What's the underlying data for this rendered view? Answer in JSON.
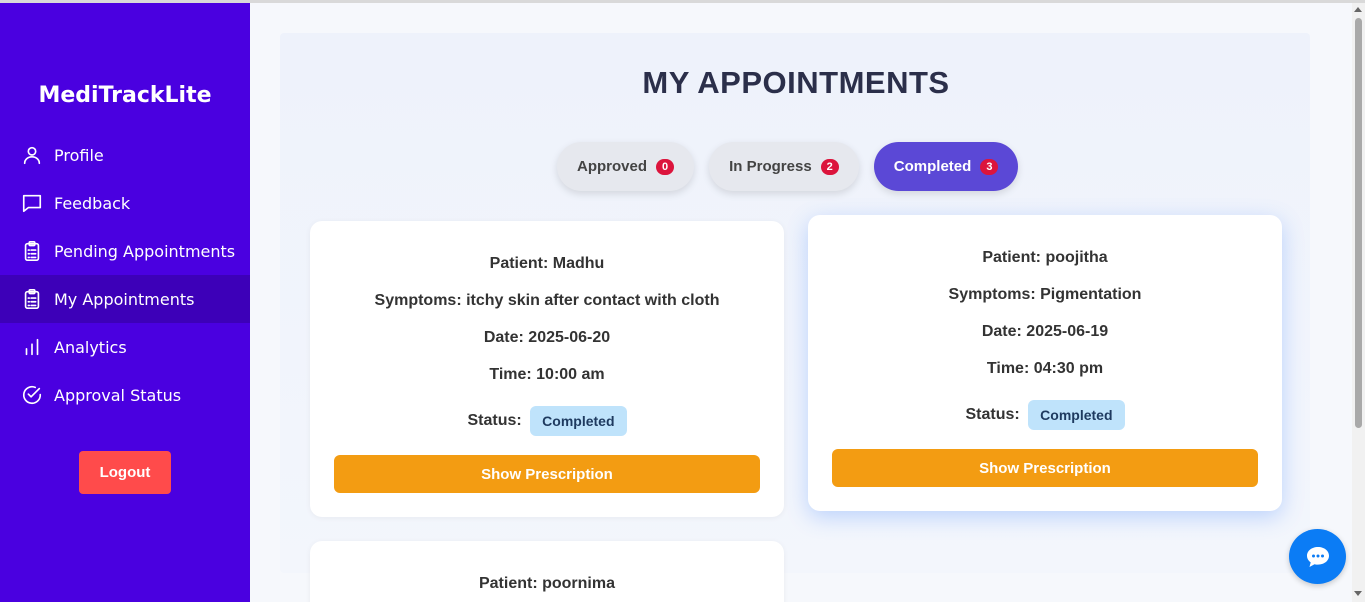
{
  "sidebar": {
    "brand": "MediTrackLite",
    "items": [
      {
        "label": "Profile",
        "icon": "user-icon"
      },
      {
        "label": "Feedback",
        "icon": "chat-bubble-icon"
      },
      {
        "label": "Pending Appointments",
        "icon": "clipboard-icon"
      },
      {
        "label": "My Appointments",
        "icon": "clipboard-icon",
        "active": true
      },
      {
        "label": "Analytics",
        "icon": "bar-chart-icon"
      },
      {
        "label": "Approval Status",
        "icon": "check-circle-icon"
      }
    ],
    "logout_label": "Logout"
  },
  "main": {
    "title": "MY APPOINTMENTS",
    "tabs": [
      {
        "label": "Approved",
        "count": "0"
      },
      {
        "label": "In Progress",
        "count": "2"
      },
      {
        "label": "Completed",
        "count": "3",
        "active": true
      }
    ],
    "appointments": [
      {
        "patient": "Patient: Madhu",
        "symptoms": "Symptoms: itchy skin after contact with cloth",
        "date": "Date: 2025-06-20",
        "time": "Time: 10:00 am",
        "status_label": "Status:",
        "status": "Completed",
        "button": "Show Prescription"
      },
      {
        "patient": "Patient: poojitha",
        "symptoms": "Symptoms: Pigmentation",
        "date": "Date: 2025-06-19",
        "time": "Time: 04:30 pm",
        "status_label": "Status:",
        "status": "Completed",
        "button": "Show Prescription"
      },
      {
        "patient": "Patient: poornima"
      }
    ]
  },
  "colors": {
    "sidebar_bg": "#4a00e0",
    "sidebar_active": "#3d00b8",
    "logout": "#ff4b4b",
    "active_tab": "#5b48d6",
    "badge": "#dc143c",
    "prescription_button": "#f39c12",
    "status_badge": "#bfe3fb",
    "chat_button": "#0b7cf5"
  },
  "chat_icon": "chat-icon"
}
